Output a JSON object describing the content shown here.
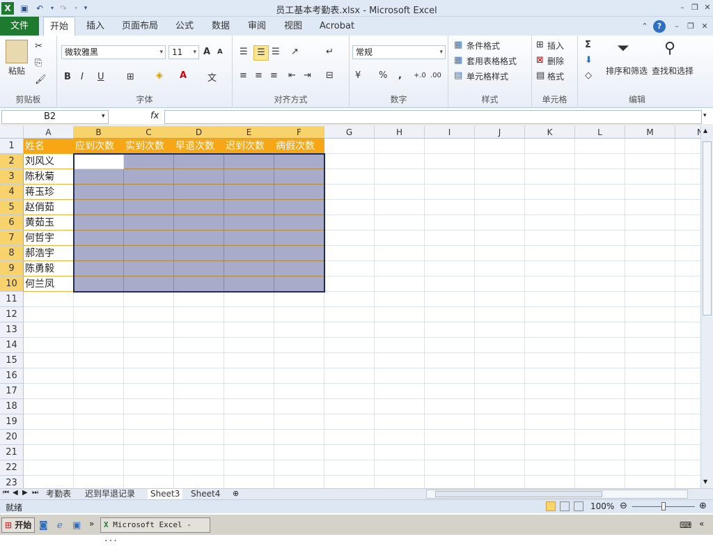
{
  "window": {
    "title": "员工基本考勤表.xlsx - Microsoft Excel"
  },
  "tabs": [
    "文件",
    "开始",
    "插入",
    "页面布局",
    "公式",
    "数据",
    "审阅",
    "视图",
    "Acrobat"
  ],
  "ribbon": {
    "clipboard": {
      "label": "剪贴板",
      "paste": "粘贴"
    },
    "font": {
      "label": "字体",
      "name": "微软雅黑",
      "size": "11",
      "bold": "B",
      "italic": "I",
      "underline": "U",
      "grow": "A",
      "shrink": "A"
    },
    "alignment": {
      "label": "对齐方式"
    },
    "number": {
      "label": "数字",
      "format": "常规",
      "percent": "%",
      "comma": ",",
      "inc_decimal": "+.0",
      "dec_decimal": ".00"
    },
    "styles": {
      "label": "样式",
      "conditional": "条件格式",
      "table": "套用表格格式",
      "cell": "单元格样式"
    },
    "cells": {
      "label": "单元格",
      "insert": "插入",
      "delete": "删除",
      "format": "格式"
    },
    "editing": {
      "label": "编辑",
      "sigma": "Σ",
      "sort": "排序和筛选",
      "find": "查找和选择"
    }
  },
  "formula_bar": {
    "name_box": "B2",
    "fx": "fx",
    "value": ""
  },
  "columns": [
    "A",
    "B",
    "C",
    "D",
    "E",
    "F",
    "G",
    "H",
    "I",
    "J",
    "K",
    "L",
    "M",
    "N"
  ],
  "rows": [
    "1",
    "2",
    "3",
    "4",
    "5",
    "6",
    "7",
    "8",
    "9",
    "10",
    "11",
    "12",
    "13",
    "14",
    "15",
    "16",
    "17",
    "18",
    "19",
    "20",
    "21",
    "22",
    "23"
  ],
  "table": {
    "headers": [
      "姓名",
      "应到次数",
      "实到次数",
      "早退次数",
      "迟到次数",
      "病假次数"
    ],
    "names": [
      "刘风义",
      "陈秋菊",
      "蒋玉珍",
      "赵俏茹",
      "黄茹玉",
      "何哲宇",
      "郝浩宇",
      "陈勇毅",
      "何兰凤"
    ]
  },
  "sheets": [
    "考勤表",
    "迟到早退记录",
    "Sheet3",
    "Sheet4"
  ],
  "active_sheet": "Sheet3",
  "status": {
    "ready": "就绪",
    "zoom": "100%"
  },
  "taskbar": {
    "start": "开始",
    "excel_task": "Microsoft Excel - ..."
  },
  "colors": {
    "header_orange": "#f7a616",
    "selection": "#a8acca",
    "excel_green": "#1e7a2f"
  }
}
